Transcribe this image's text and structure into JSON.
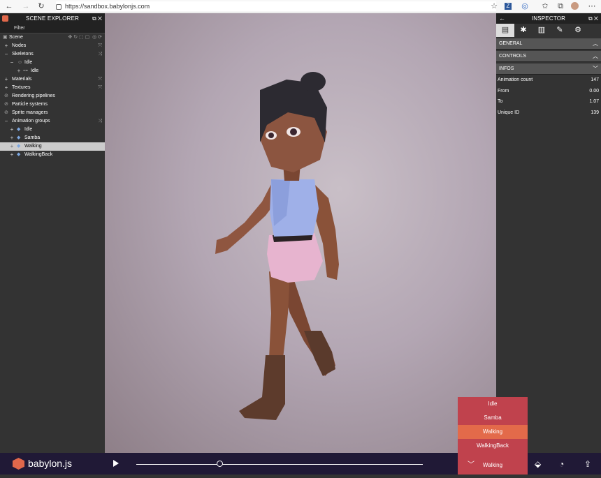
{
  "browser": {
    "url": "https://sandbox.babylonjs.com"
  },
  "explorer": {
    "title": "SCENE EXPLORER",
    "filter_placeholder": "Filter",
    "rows": [
      {
        "label": "Scene",
        "expander": "",
        "indent": 0
      },
      {
        "label": "Nodes",
        "expander": "+",
        "indent": 0
      },
      {
        "label": "Skeletons",
        "expander": "−",
        "indent": 0
      },
      {
        "label": "Idle",
        "expander": "−",
        "indent": 1
      },
      {
        "label": "Idle",
        "expander": "+",
        "indent": 2
      },
      {
        "label": "Materials",
        "expander": "+",
        "indent": 0
      },
      {
        "label": "Textures",
        "expander": "+",
        "indent": 0
      },
      {
        "label": "Rendering pipelines",
        "expander": "",
        "indent": 0
      },
      {
        "label": "Particle systems",
        "expander": "",
        "indent": 0
      },
      {
        "label": "Sprite managers",
        "expander": "",
        "indent": 0
      },
      {
        "label": "Animation groups",
        "expander": "−",
        "indent": 0
      },
      {
        "label": "Idle",
        "expander": "+",
        "indent": 1
      },
      {
        "label": "Samba",
        "expander": "+",
        "indent": 1
      },
      {
        "label": "Walking",
        "expander": "+",
        "indent": 1
      },
      {
        "label": "WalkingBack",
        "expander": "+",
        "indent": 1
      }
    ]
  },
  "inspector": {
    "title": "INSPECTOR",
    "sections": {
      "general": "GENERAL",
      "controls": "CONTROLS",
      "infos": "INFOS"
    },
    "infos": [
      {
        "label": "Animation count",
        "value": "147"
      },
      {
        "label": "From",
        "value": "0.00"
      },
      {
        "label": "To",
        "value": "1.07"
      },
      {
        "label": "Unique ID",
        "value": "139"
      }
    ]
  },
  "bottom": {
    "brand": "babylon.js",
    "progress": 0.29
  },
  "animation_menu": {
    "items": [
      "Idle",
      "Samba",
      "Walking",
      "WalkingBack"
    ],
    "active": "Walking",
    "selected": "Walking"
  },
  "colors": {
    "brand": "#e0684b",
    "menu": "#c0424d",
    "menu_active": "#e36a4a",
    "bottom_bar": "#201936"
  }
}
